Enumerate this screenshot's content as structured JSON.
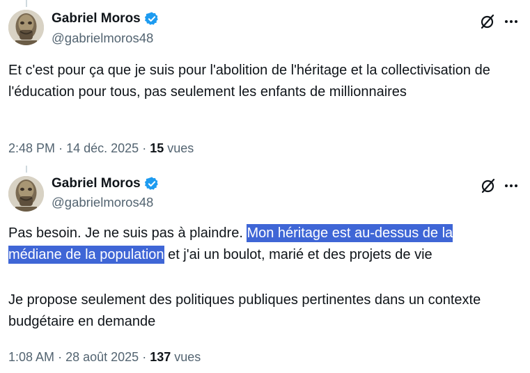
{
  "tweets": [
    {
      "author": {
        "display_name": "Gabriel Moros",
        "handle": "@gabrielmoros48",
        "verified": true
      },
      "text": "Et c'est pour ça que je suis pour l'abolition de l'héritage et la collectivisation de l'éducation pour tous, pas seulement les enfants de millionnaires",
      "time": "2:48 PM",
      "separator": "·",
      "date": "14 déc. 2025",
      "views_count": "15",
      "views_label": "vues"
    },
    {
      "author": {
        "display_name": "Gabriel Moros",
        "handle": "@gabrielmoros48",
        "verified": true
      },
      "text_before": "Pas besoin. Je ne suis pas à plaindre. ",
      "text_highlighted_1": "Mon héritage est au-dessus de la",
      "text_highlighted_2": "médiane de la population",
      "text_after": " et j'ai un boulot, marié et des projets de vie",
      "text_paragraph_2": "Je propose seulement des politiques publiques pertinentes dans un contexte budgétaire en demande",
      "time": "1:08 AM",
      "separator": "·",
      "date": "28 août 2025",
      "views_count": "137",
      "views_label": "vues"
    }
  ],
  "colors": {
    "verified_badge": "#1d9bf0",
    "highlight": "#3f66d6",
    "secondary_text": "#536471",
    "primary_text": "#0f1419"
  },
  "icons": [
    "verified-badge-icon",
    "grok-icon",
    "more-icon"
  ]
}
